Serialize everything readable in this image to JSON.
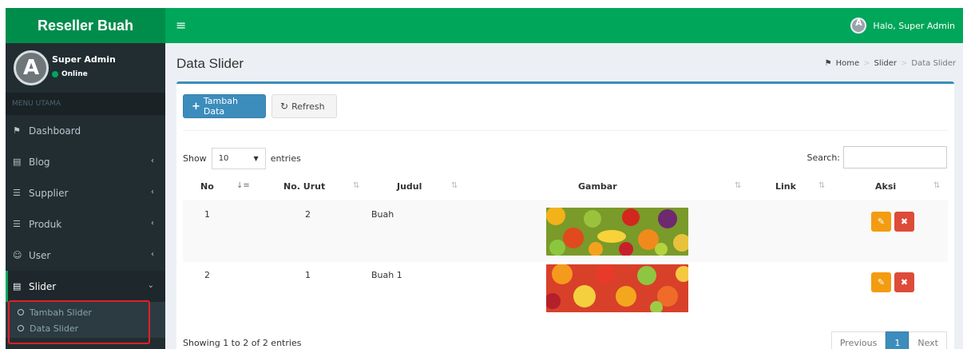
{
  "app": {
    "brand": "Reseller Buah"
  },
  "topbar": {
    "menu_icon": "bars-icon",
    "user_greeting": "Halo, Super Admin"
  },
  "sidebar": {
    "user": {
      "name": "Super Admin",
      "status": "Online"
    },
    "menu_header": "MENU UTAMA",
    "items": [
      {
        "label": "Dashboard",
        "icon": "dashboard-icon",
        "has_chevron": false
      },
      {
        "label": "Blog",
        "icon": "newspaper-icon",
        "has_chevron": true
      },
      {
        "label": "Supplier",
        "icon": "cart-icon",
        "has_chevron": true
      },
      {
        "label": "Produk",
        "icon": "cart-icon",
        "has_chevron": true
      },
      {
        "label": "User",
        "icon": "users-icon",
        "has_chevron": true
      },
      {
        "label": "Slider",
        "icon": "newspaper-icon",
        "has_chevron": true,
        "expanded": true
      }
    ],
    "submenu": [
      {
        "label": "Tambah Slider"
      },
      {
        "label": "Data Slider"
      }
    ]
  },
  "page": {
    "title": "Data Slider",
    "breadcrumb": [
      "Home",
      "Slider",
      "Data Slider"
    ]
  },
  "toolbar": {
    "add_label": "Tambah Data",
    "refresh_label": "Refresh"
  },
  "table_controls": {
    "show_label": "Show",
    "entries_value": "10",
    "entries_label": "entries",
    "search_label": "Search:",
    "search_value": ""
  },
  "table": {
    "columns": [
      "No",
      "No. Urut",
      "Judul",
      "Gambar",
      "Link",
      "Aksi"
    ],
    "rows": [
      {
        "no": "1",
        "no_urut": "2",
        "judul": "Buah",
        "link": ""
      },
      {
        "no": "2",
        "no_urut": "1",
        "judul": "Buah 1",
        "link": ""
      }
    ]
  },
  "footer": {
    "info": "Showing 1 to 2 of 2 entries",
    "pagination": {
      "previous": "Previous",
      "current": "1",
      "next": "Next"
    }
  },
  "colors": {
    "topbar": "#00a65a",
    "brand_bg": "#008d4c",
    "sidebar_bg": "#222d32",
    "primary": "#3c8dbc",
    "warning": "#f39c12",
    "danger": "#dd4b39",
    "highlight_box": "#e41e24"
  }
}
